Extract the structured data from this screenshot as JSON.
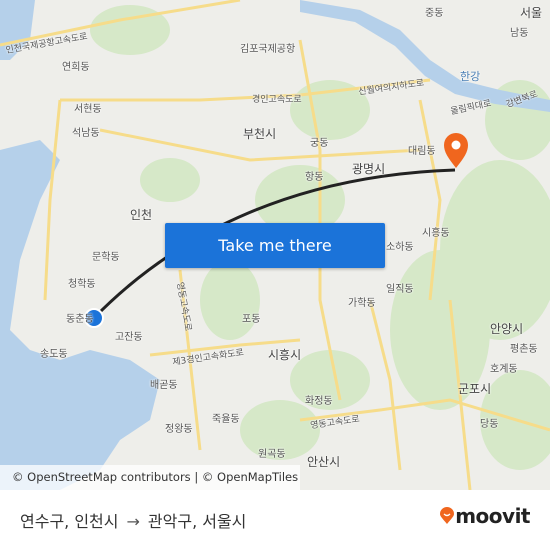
{
  "map": {
    "labels": {
      "airport_expressway": "인천국제공항고속도로",
      "yeonhui": "연희동",
      "seohyeon": "서현동",
      "seoknam": "석남동",
      "incheon": "인천",
      "munhak": "문학동",
      "cheonghak": "청학동",
      "dongchun": "동춘동",
      "songdo": "송도동",
      "gojan": "고잔동",
      "baegot": "배곧동",
      "jeongwang": "정왕동",
      "jugyul": "죽율동",
      "wongok": "원곡동",
      "ansan": "안산시",
      "siheung_city": "시흥시",
      "po": "포동",
      "hwajeong": "화정동",
      "yeongdong_exp": "영동고속도로",
      "yeongdong_exp2": "영동고속도로",
      "third_gyeongin": "제3경인고속화도로",
      "gimpo_airport": "김포국제공항",
      "gyeongin_exp": "경인고속도로",
      "bucheon": "부천시",
      "gung": "궁동",
      "hang": "항동",
      "gwangmyeong": "광명시",
      "sinwol": "신월여의지하도로",
      "hangang": "한강",
      "olympic": "올림픽대로",
      "daerim": "대림동",
      "siheung_dong": "시흥동",
      "soha": "소하동",
      "iljik": "일직동",
      "gahak": "가학동",
      "anyang": "안양시",
      "pyeongchon": "평촌동",
      "hogye": "호계동",
      "gunpo": "군포시",
      "dang": "당동",
      "seoul": "서울",
      "jung": "중동",
      "nam": "남동",
      "gyeongbu": "강변북로"
    },
    "route_color": "#222222",
    "destination_pin_color": "#f0661e",
    "origin_dot_color": "#1b73d9"
  },
  "cta": {
    "label": "Take me there"
  },
  "attribution": "© OpenStreetMap contributors | © OpenMapTiles",
  "footer": {
    "origin": "연수구, 인천시",
    "arrow": "→",
    "destination": "관악구, 서울시",
    "brand": "moovit",
    "brand_color": "#f0661e"
  }
}
